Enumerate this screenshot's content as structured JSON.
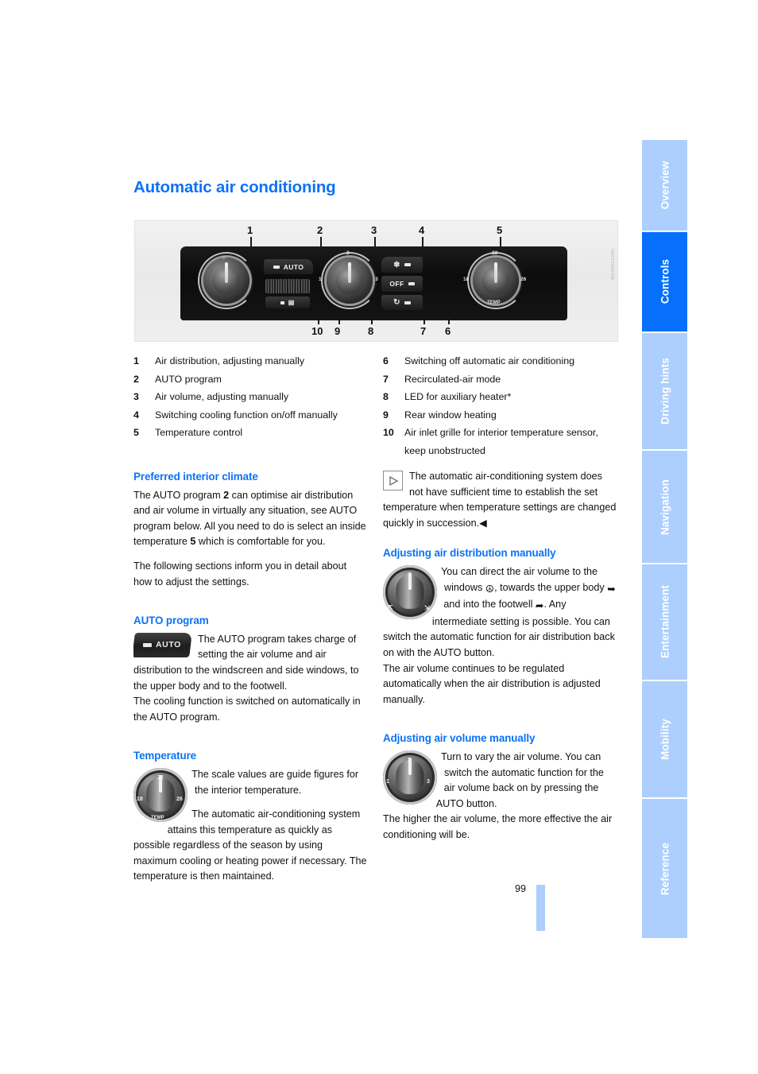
{
  "page": {
    "title": "Automatic air conditioning",
    "number": "99",
    "figure_caption": "WK5A6CD0AV"
  },
  "sidebar": {
    "tabs": [
      {
        "label": "Overview",
        "active": false
      },
      {
        "label": "Controls",
        "active": true
      },
      {
        "label": "Driving hints",
        "active": false
      },
      {
        "label": "Navigation",
        "active": false
      },
      {
        "label": "Entertainment",
        "active": false
      },
      {
        "label": "Mobility",
        "active": false
      },
      {
        "label": "Reference",
        "active": false
      }
    ],
    "active_color": "#0670fb",
    "inactive_color": "#adcffd"
  },
  "figure": {
    "callouts_top": [
      "1",
      "2",
      "3",
      "4",
      "5"
    ],
    "callouts_bottom": [
      "10",
      "9",
      "8",
      "7",
      "6"
    ],
    "panel": {
      "auto_button_label": "AUTO",
      "off_button_label": "OFF",
      "air_volume_ticks": [
        "1",
        "2",
        "3"
      ],
      "temperature_ticks": [
        "18",
        "22",
        "26"
      ],
      "temperature_label": "TEMP"
    }
  },
  "legend": {
    "left": [
      {
        "num": "1",
        "text": "Air distribution, adjusting manually"
      },
      {
        "num": "2",
        "text": "AUTO program"
      },
      {
        "num": "3",
        "text": "Air volume, adjusting manually"
      },
      {
        "num": "4",
        "text": "Switching cooling function on/off manually"
      },
      {
        "num": "5",
        "text": "Temperature control"
      }
    ],
    "right": [
      {
        "num": "6",
        "text": "Switching off automatic air conditioning"
      },
      {
        "num": "7",
        "text": "Recirculated-air mode"
      },
      {
        "num": "8",
        "text": "LED for auxiliary heater*"
      },
      {
        "num": "9",
        "text": "Rear window heating"
      },
      {
        "num": "10",
        "text": "Air inlet grille for interior temperature sensor, keep unobstructed"
      }
    ]
  },
  "sections": {
    "preferred_climate": {
      "heading": "Preferred interior climate",
      "p1_a": "The AUTO program ",
      "p1_ref1": "2",
      "p1_b": " can optimise air distribution and air volume in virtually any situation, see AUTO program below. All you need to do is select an inside temperature ",
      "p1_ref2": "5",
      "p1_c": " which is comfortable for you.",
      "p2": "The following sections inform you in detail about how to adjust the settings."
    },
    "auto_program": {
      "heading": "AUTO program",
      "p1": "The AUTO program takes charge of setting the air volume and air distribution to the windscreen and side windows, to the upper body and to the footwell.",
      "p2": "The cooling function is switched on automatically in the AUTO program."
    },
    "temperature": {
      "heading": "Temperature",
      "p1": "The scale values are guide figures for the interior temperature.",
      "p2": "The automatic air-conditioning system attains this temperature as quickly as possible regardless of the season by using maximum cooling or heating power if necessary. The temperature is then maintained."
    },
    "note": {
      "text": "The automatic air-conditioning system does not have sufficient time to establish the set temperature when temperature settings are changed quickly in succession.",
      "end_marker": "◀"
    },
    "air_distribution": {
      "heading": "Adjusting air distribution manually",
      "p1_a": "You can direct the air volume to the windows ",
      "p1_b": ", towards the upper body ",
      "p1_c": " and into the footwell ",
      "p1_d": ". Any intermediate setting is possible. You can switch the automatic function for air distribution back on with the AUTO button.",
      "p2": "The air volume continues to be regulated automatically when the air distribution is adjusted manually."
    },
    "air_volume": {
      "heading": "Adjusting air volume manually",
      "p1": "Turn to vary the air volume. You can switch the automatic function for the air volume back on by pressing the AUTO button.",
      "p2": "The higher the air volume, the more effective the air conditioning will be."
    }
  },
  "colors": {
    "heading_blue": "#0b72f5",
    "text_black": "#111111",
    "figure_bg": "#eeeeee"
  }
}
